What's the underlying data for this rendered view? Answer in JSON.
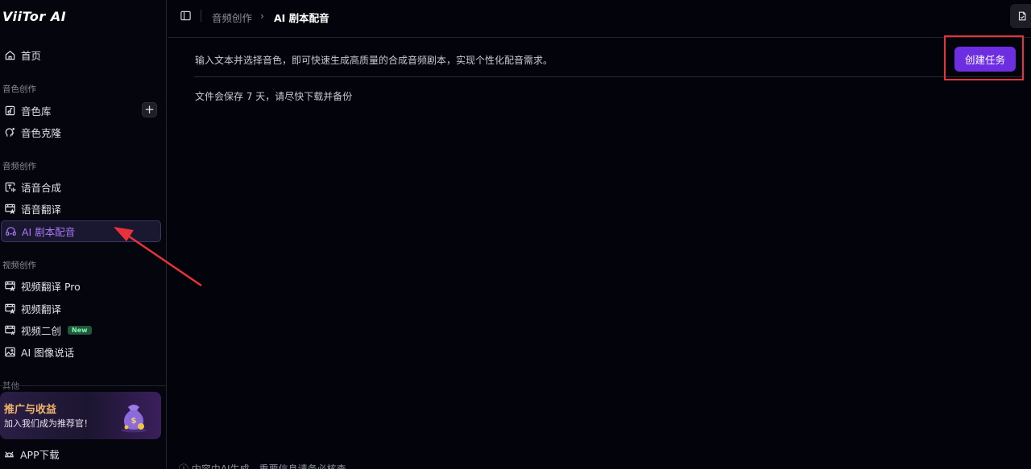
{
  "logo": "ViiTor AI",
  "sidebar": {
    "home": "首页",
    "section_voice": "音色创作",
    "voice_library": "音色库",
    "voice_clone": "音色克隆",
    "section_audio": "音频创作",
    "tts": "语音合成",
    "speech_translate": "语音翻译",
    "ai_script_dubbing": "AI 剧本配音",
    "section_video": "视频创作",
    "video_translate_pro": "视频翻译 Pro",
    "video_translate": "视频翻译",
    "video_remix": "视频二创",
    "new_badge": "New",
    "ai_image_narration": "AI 图像说话",
    "section_other": "其他",
    "promo_title": "推广与收益",
    "promo_sub": "加入我们成为推荐官！",
    "app_download": "APP下载"
  },
  "breadcrumb": {
    "parent": "音频创作",
    "current": "AI 剧本配音"
  },
  "main": {
    "description": "输入文本并选择音色，即可快速生成高质量的合成音频剧本，实现个性化配音需求。",
    "note": "文件会保存 7 天，请尽快下载并备份",
    "create_button": "创建任务",
    "footer_note": "ⓘ 内容由AI生成，重要信息请务必核查"
  },
  "colors": {
    "accent": "#6c2ee0",
    "active_text": "#a779f6",
    "highlight_box": "#e8323a"
  }
}
